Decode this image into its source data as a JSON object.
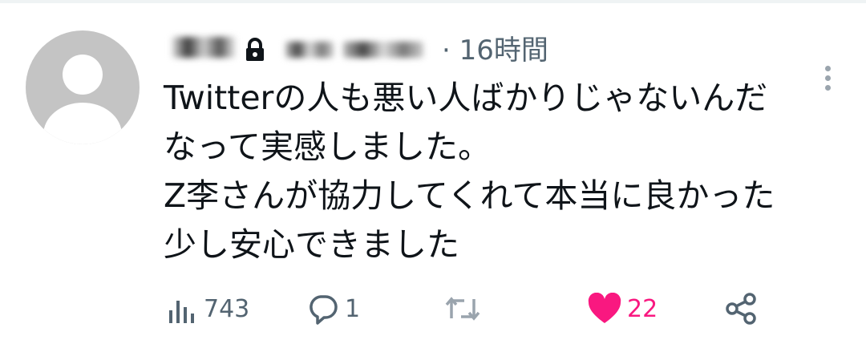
{
  "tweet": {
    "author": {
      "name": "",
      "handle": ""
    },
    "time": "· 16時間",
    "text_lines": [
      "Twitterの人も悪い人ばかりじゃないんだ",
      "なって実感しました。",
      "Z李さんが協力してくれて本当に良かった",
      "少し安心できました"
    ]
  },
  "actions": {
    "views": {
      "icon": "views-icon",
      "count": "743"
    },
    "replies": {
      "icon": "reply-icon",
      "count": "1"
    },
    "retweets": {
      "icon": "retweet-icon",
      "count": ""
    },
    "likes": {
      "icon": "heart-icon",
      "count": "22"
    },
    "share": {
      "icon": "share-icon"
    }
  },
  "colors": {
    "text": "#0f1419",
    "secondary": "#536471",
    "like": "#f91880",
    "icon_muted": "#9aa4ad",
    "avatar_bg": "#c4c4c4"
  }
}
